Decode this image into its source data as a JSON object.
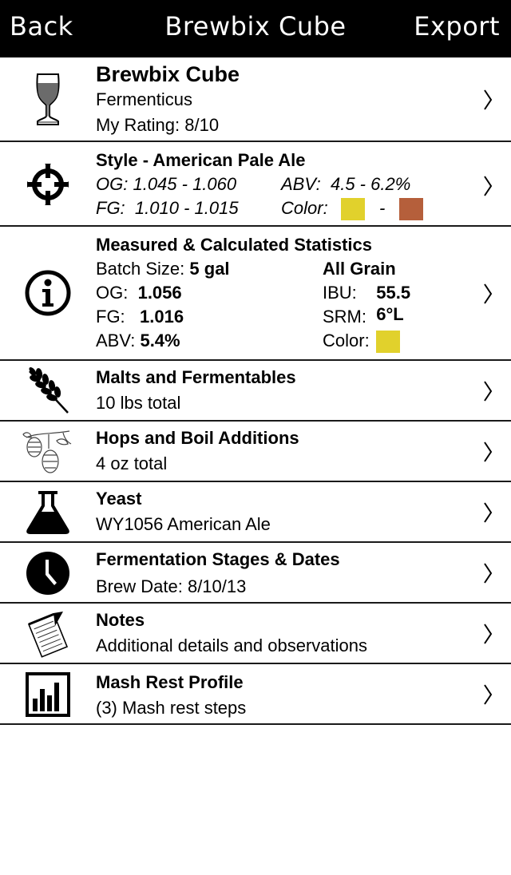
{
  "nav": {
    "back": "Back",
    "title": "Brewbix Cube",
    "export": "Export"
  },
  "recipe": {
    "name": "Brewbix Cube",
    "brewer": "Fermenticus",
    "rating_label": "My Rating:",
    "rating_value": "8/10"
  },
  "style": {
    "heading": "Style - American Pale Ale",
    "og_label": "OG:",
    "og_range": "1.045 - 1.060",
    "abv_label": "ABV:",
    "abv_range": "4.5 - 6.2%",
    "fg_label": "FG:",
    "fg_range": "1.010 - 1.015",
    "color_label": "Color:",
    "color_sep": "-",
    "color_low": "#e1d12c",
    "color_high": "#b55f3b"
  },
  "stats": {
    "heading": "Measured & Calculated Statistics",
    "batch_label": "Batch Size:",
    "batch_value": "5 gal",
    "method": "All Grain",
    "og_label": "OG:",
    "og_value": "1.056",
    "ibu_label": "IBU:",
    "ibu_value": "55.5",
    "fg_label": "FG:",
    "fg_value": "1.016",
    "srm_label": "SRM:",
    "srm_value": "6°L",
    "abv_label": "ABV:",
    "abv_value": "5.4%",
    "color_label": "Color:",
    "color": "#e1d12c"
  },
  "malts": {
    "heading": "Malts and Fermentables",
    "detail": "10 lbs total"
  },
  "hops": {
    "heading": "Hops and Boil Additions",
    "detail": "4 oz total"
  },
  "yeast": {
    "heading": "Yeast",
    "detail": "WY1056 American Ale"
  },
  "fermentation": {
    "heading": "Fermentation Stages & Dates",
    "detail_label": "Brew Date:",
    "detail_value": "8/10/13"
  },
  "notes": {
    "heading": "Notes",
    "detail": "Additional details and observations"
  },
  "mash": {
    "heading": "Mash Rest Profile",
    "detail": "(3) Mash rest steps"
  }
}
